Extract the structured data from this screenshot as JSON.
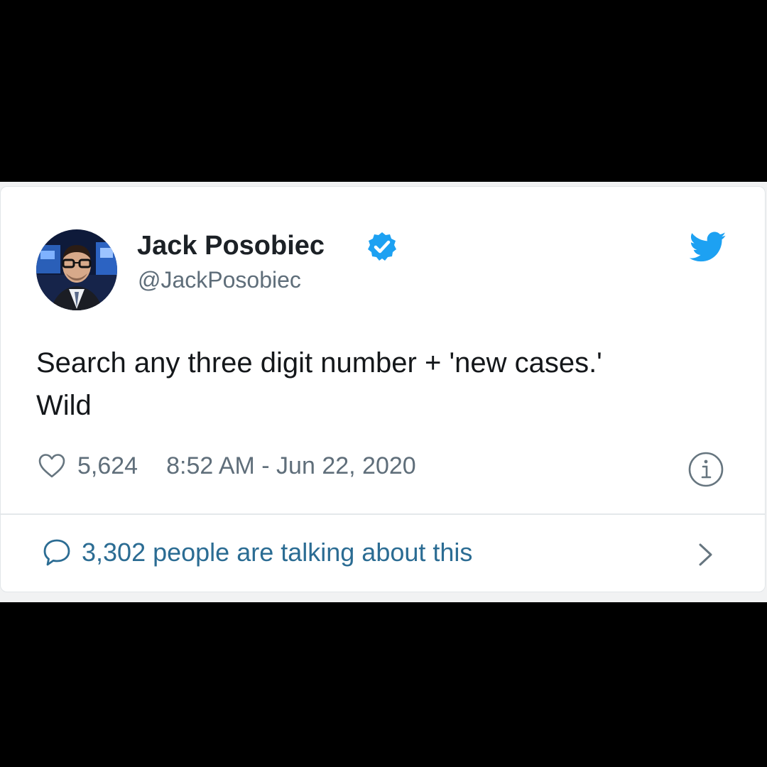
{
  "tweet": {
    "author": {
      "name": "Jack Posobiec",
      "handle": "@JackPosobiec",
      "verified": true,
      "avatar_icon": "profile-photo"
    },
    "brand_icon": "twitter-bird-icon",
    "text_lines": [
      "Search any three digit number + 'new cases.'",
      "Wild"
    ],
    "likes": "5,624",
    "timestamp": "8:52 AM - Jun 22, 2020",
    "conversation": "3,302 people are talking about this"
  },
  "icons": {
    "like": "heart-icon",
    "info": "info-icon",
    "reply": "speech-bubble-icon",
    "more": "chevron-right-icon"
  },
  "colors": {
    "background": "#000000",
    "card": "#ffffff",
    "verified_blue": "#1da1f2",
    "link_blue": "#2b6c93",
    "muted_text": "#5f6e7a",
    "body_text": "#14171a"
  }
}
